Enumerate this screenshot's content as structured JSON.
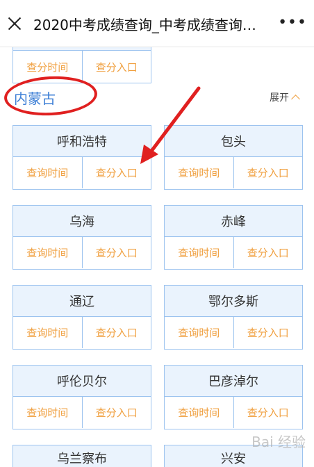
{
  "header": {
    "title": "2020中考成绩查询_中考成绩查询…",
    "more": "•••"
  },
  "links": {
    "time": "查询时间",
    "score": "查分入口",
    "score_top": "查分入口",
    "time_top": "查分时间"
  },
  "region": {
    "name": "内蒙古",
    "expand_label": "展开"
  },
  "cities": [
    {
      "name": "呼和浩特"
    },
    {
      "name": "包头"
    },
    {
      "name": "乌海"
    },
    {
      "name": "赤峰"
    },
    {
      "name": "通辽"
    },
    {
      "name": "鄂尔多斯"
    },
    {
      "name": "呼伦贝尔"
    },
    {
      "name": "巴彦淖尔"
    },
    {
      "name": "乌兰察布"
    },
    {
      "name": "兴安"
    }
  ],
  "watermark": "Bai 经验"
}
